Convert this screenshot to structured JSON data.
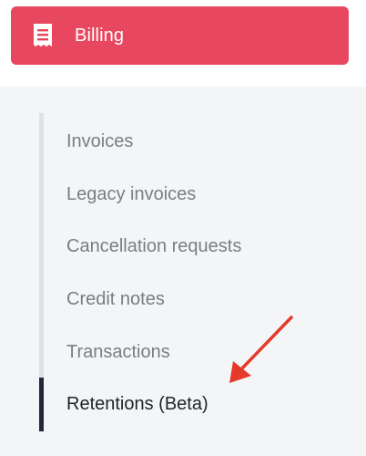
{
  "billing_button": {
    "label": "Billing",
    "icon": "receipt-icon",
    "color": "#e8485f"
  },
  "menu": {
    "items": [
      {
        "label": "Invoices",
        "active": false
      },
      {
        "label": "Legacy invoices",
        "active": false
      },
      {
        "label": "Cancellation requests",
        "active": false
      },
      {
        "label": "Credit notes",
        "active": false
      },
      {
        "label": "Transactions",
        "active": false
      },
      {
        "label": "Retentions (Beta)",
        "active": true
      }
    ],
    "active_indicator_color": "#1f2937",
    "track_color": "#dfe1e5"
  },
  "annotation": {
    "type": "arrow",
    "color": "#e53a2b",
    "points_to": "Retentions (Beta)"
  }
}
